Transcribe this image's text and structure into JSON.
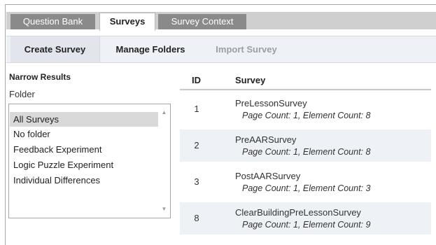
{
  "tabs": [
    {
      "label": "Question Bank",
      "active": false
    },
    {
      "label": "Surveys",
      "active": true
    },
    {
      "label": "Survey Context",
      "active": false
    }
  ],
  "toolbar": {
    "create_survey": "Create Survey",
    "manage_folders": "Manage Folders",
    "import_survey": "Import Survey"
  },
  "sidebar": {
    "title": "Narrow Results",
    "folder_label": "Folder",
    "folders": [
      {
        "label": "All Surveys",
        "selected": true
      },
      {
        "label": "No folder",
        "selected": false
      },
      {
        "label": "Feedback Experiment",
        "selected": false
      },
      {
        "label": "Logic Puzzle Experiment",
        "selected": false
      },
      {
        "label": "Individual Differences",
        "selected": false
      }
    ]
  },
  "table": {
    "columns": [
      "ID",
      "Survey"
    ],
    "rows": [
      {
        "id": "1",
        "name": "PreLessonSurvey",
        "meta": "Page Count: 1, Element Count: 8"
      },
      {
        "id": "2",
        "name": "PreAARSurvey",
        "meta": "Page Count: 1, Element Count: 8"
      },
      {
        "id": "3",
        "name": "PostAARSurvey",
        "meta": "Page Count: 1, Element Count: 3"
      },
      {
        "id": "8",
        "name": "ClearBuildingPreLessonSurvey",
        "meta": "Page Count: 1, Element Count: 9"
      }
    ]
  },
  "colors": {
    "tab_inactive": "#8a8a8a",
    "toolbar_bg": "#eef1f5",
    "row_alt": "#eef2f7",
    "disabled_text": "#9aa0a6"
  }
}
